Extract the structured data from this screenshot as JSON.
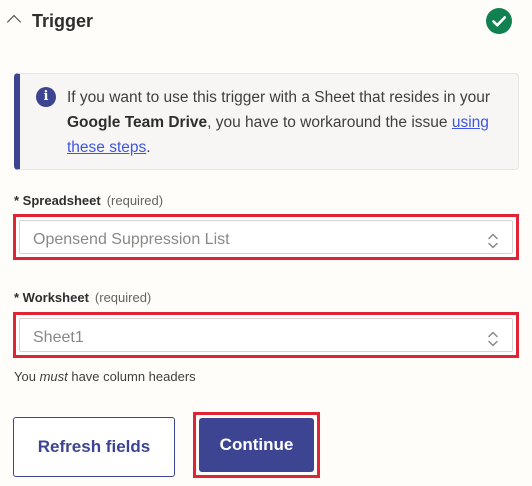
{
  "section": {
    "title": "Trigger",
    "status": "complete",
    "status_color": "#128152",
    "collapse_icon": "chevron-up-icon",
    "status_icon": "check-circle-icon"
  },
  "info": {
    "icon": "info-icon",
    "icon_glyph": "i",
    "text_before": "If you want to use this trigger with a Sheet that resides in your ",
    "text_bold": "Google Team Drive",
    "text_middle": ", you have to workaround the issue ",
    "link_text": "using these steps",
    "text_after": ".",
    "accent_color": "#3d4592"
  },
  "spreadsheet": {
    "label": "* Spreadsheet",
    "required": "(required)",
    "value": "Opensend Suppression List"
  },
  "worksheet": {
    "label": "* Worksheet",
    "required": "(required)",
    "value": "Sheet1",
    "hint_before": "You ",
    "hint_em": "must",
    "hint_after": " have column headers"
  },
  "buttons": {
    "refresh": "Refresh fields",
    "continue": "Continue"
  },
  "highlight_color": "#e02435"
}
